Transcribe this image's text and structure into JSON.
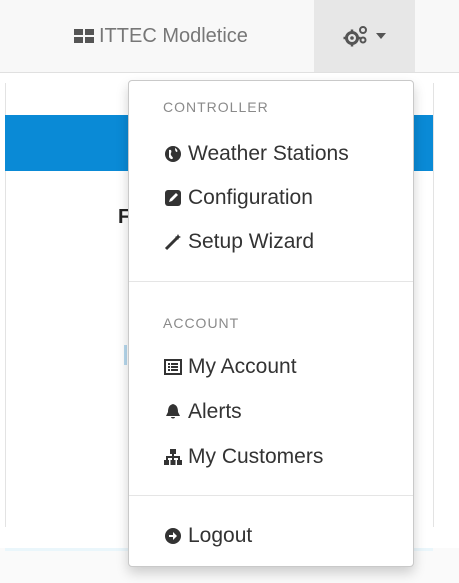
{
  "navbar": {
    "brand_label": "ITTEC Modletice",
    "brand_icon": "th-large-icon",
    "settings_icon": "cogs-icon",
    "caret_icon": "caret-down-icon"
  },
  "dropdown": {
    "sections": [
      {
        "header": "CONTROLLER",
        "items": [
          {
            "label": "Weather Stations",
            "icon": "globe-icon"
          },
          {
            "label": "Configuration",
            "icon": "edit-icon"
          },
          {
            "label": "Setup Wizard",
            "icon": "magic-wand-icon"
          }
        ]
      },
      {
        "header": "ACCOUNT",
        "items": [
          {
            "label": "My Account",
            "icon": "list-alt-icon"
          },
          {
            "label": "Alerts",
            "icon": "bell-icon"
          },
          {
            "label": "My Customers",
            "icon": "sitemap-icon"
          }
        ]
      }
    ],
    "logout": {
      "label": "Logout",
      "icon": "arrow-circle-right-icon"
    }
  },
  "colors": {
    "accent_bar": "#0a8ad6",
    "navbar_bg": "#f8f8f8",
    "toggle_active_bg": "#e7e7e7"
  }
}
